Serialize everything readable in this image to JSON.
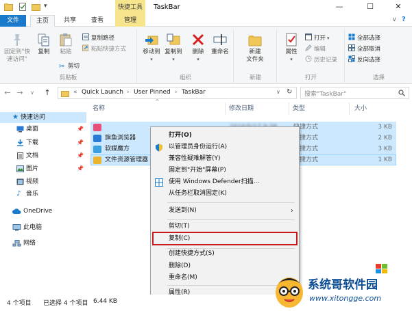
{
  "window": {
    "title": "TaskBar",
    "context_tab_header": "快捷工具",
    "controls": {
      "minimize": "—",
      "maximize": "☐",
      "close": "✕"
    }
  },
  "ribbon_tabs": [
    "文件",
    "主页",
    "共享",
    "查看",
    "管理"
  ],
  "ribbon": {
    "clipboard": {
      "pin_label": "固定到\"快\n速访问\"",
      "copy_label": "复制",
      "paste_label": "粘贴",
      "copy_path": "复制路径",
      "paste_shortcut": "粘贴快捷方式",
      "cut": "剪切",
      "group_label": "剪贴板"
    },
    "organize": {
      "move_to": "移动到",
      "copy_to": "复制到",
      "delete": "删除",
      "rename": "重命名",
      "group_label": "组织"
    },
    "new": {
      "new_folder": "新建\n文件夹",
      "group_label": "新建"
    },
    "open": {
      "properties": "属性",
      "open": "打开",
      "edit": "编辑",
      "history": "历史记录",
      "group_label": "打开"
    },
    "select": {
      "select_all": "全部选择",
      "select_none": "全部取消",
      "invert": "反向选择",
      "group_label": "选择"
    }
  },
  "address": {
    "back": "←",
    "forward": "→",
    "recent": "∨",
    "up": "↑",
    "crumbs": [
      "«",
      "Quick Launch",
      "›",
      "User Pinned",
      "›",
      "TaskBar"
    ],
    "dropdown": "∨",
    "refresh": "↻",
    "search_placeholder": "搜索\"TaskBar\""
  },
  "nav_pane": [
    {
      "label": "快速访问",
      "icon": "star-icon",
      "selected": true
    },
    {
      "label": "桌面",
      "icon": "desktop-folder-icon",
      "pinned": true
    },
    {
      "label": "下载",
      "icon": "download-folder-icon",
      "pinned": true
    },
    {
      "label": "文档",
      "icon": "documents-folder-icon",
      "pinned": true
    },
    {
      "label": "图片",
      "icon": "pictures-folder-icon",
      "pinned": true
    },
    {
      "label": "视频",
      "icon": "videos-folder-icon"
    },
    {
      "label": "音乐",
      "icon": "music-folder-icon"
    },
    {
      "label": "OneDrive",
      "icon": "onedrive-cloud-icon"
    },
    {
      "label": "此电脑",
      "icon": "computer-icon"
    },
    {
      "label": "网络",
      "icon": "network-icon"
    }
  ],
  "pin_glyph": "📌",
  "columns": [
    "名称",
    "修改日期",
    "类型",
    "大小"
  ],
  "files": [
    {
      "name": "",
      "date": "2016/5/17 9:38",
      "type": "快捷方式",
      "size": "3 KB",
      "color": "#e8507a"
    },
    {
      "name": "旗鱼浏览器",
      "date": "",
      "type": "快捷方式",
      "size": "2 KB",
      "color": "#2b7bd6"
    },
    {
      "name": "软媒魔方",
      "date": "",
      "type": "快捷方式",
      "size": "3 KB",
      "color": "#3aa0e0"
    },
    {
      "name": "文件资源管理器",
      "date": "",
      "type": "快捷方式",
      "size": "1 KB",
      "color": "#e9b52f"
    }
  ],
  "context_menu": [
    {
      "label": "打开(O)",
      "bold": true
    },
    {
      "label": "以管理员身份运行(A)",
      "icon": "uac-shield-icon"
    },
    {
      "label": "兼容性疑难解答(Y)"
    },
    {
      "label": "固定到\"开始\"屏幕(P)"
    },
    {
      "label": "使用 Windows Defender扫描...",
      "icon": "defender-icon"
    },
    {
      "label": "从任务栏取消固定(K)"
    },
    {
      "label": "发送到(N)",
      "submenu": true
    },
    {
      "label": "剪切(T)"
    },
    {
      "label": "复制(C)",
      "highlight": true
    },
    {
      "label": "创建快捷方式(S)"
    },
    {
      "label": "删除(D)"
    },
    {
      "label": "重命名(M)"
    },
    {
      "label": "属性(R)"
    }
  ],
  "submenu_arrow": "›",
  "status": {
    "count": "4 个项目",
    "selected": "已选择 4 个项目",
    "size": "6.44 KB"
  },
  "watermark": {
    "title": "系统哥软件园",
    "url": "www.xitongge.com"
  },
  "colors": {
    "accent": "#1979ca",
    "selection": "#cce8ff",
    "highlight_border": "#c8191b",
    "context_tab": "#f7e58d",
    "watermark": "#0b4d94"
  }
}
